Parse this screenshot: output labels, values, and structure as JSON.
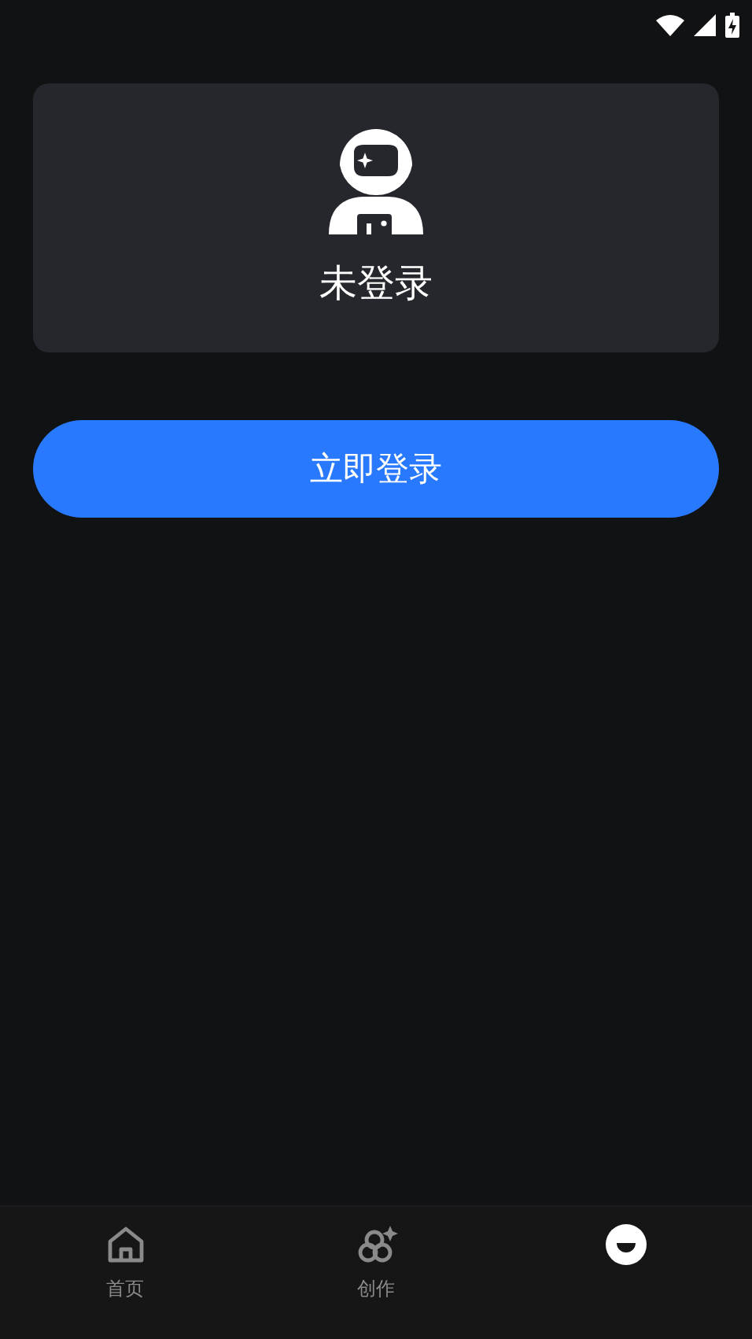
{
  "profile_card": {
    "status": "未登录"
  },
  "login_button": {
    "label": "立即登录"
  },
  "tab_bar": [
    {
      "kind": "home",
      "label": "首页",
      "selected": false
    },
    {
      "kind": "create",
      "label": "创作",
      "selected": false
    },
    {
      "kind": "me",
      "selected": true
    }
  ]
}
